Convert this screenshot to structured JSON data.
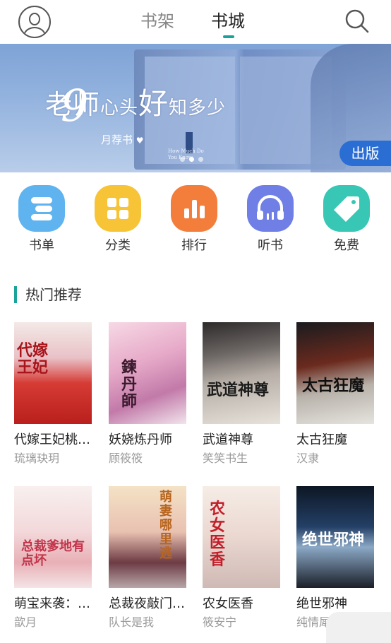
{
  "header": {
    "tabs": [
      {
        "label": "书架",
        "active": false
      },
      {
        "label": "书城",
        "active": true
      }
    ],
    "icons": {
      "left": "user-avatar-icon",
      "right": "search-icon"
    }
  },
  "banner": {
    "title_part1": "老师",
    "title_part2": "心头",
    "title_part3": "好",
    "title_part4": "知多少",
    "english_text": "How Much Do You Know",
    "number": "9",
    "subtitle": "月荐书",
    "publish_tag": "出版",
    "page_indicator": {
      "count": 3,
      "active": 1
    }
  },
  "categories": [
    {
      "label": "书单",
      "icon": "booklist-icon",
      "color": "#5fb4f0"
    },
    {
      "label": "分类",
      "icon": "category-grid-icon",
      "color": "#f6c436"
    },
    {
      "label": "排行",
      "icon": "ranking-bars-icon",
      "color": "#f37d3a"
    },
    {
      "label": "听书",
      "icon": "headphones-icon",
      "color": "#6f7fe6"
    },
    {
      "label": "免费",
      "icon": "price-tag-icon",
      "color": "#37c7b4"
    }
  ],
  "section": {
    "title": "热门推荐",
    "accent": "#1aa39a"
  },
  "books": [
    {
      "title": "代嫁王妃桃…",
      "author": "琉璃玦玥",
      "cover_text": "代嫁王妃"
    },
    {
      "title": "妖娆炼丹师",
      "author": "顾筱筱",
      "cover_text": "鍊丹師"
    },
    {
      "title": "武道神尊",
      "author": "笑笑书生",
      "cover_text": "武道神尊"
    },
    {
      "title": "太古狂魔",
      "author": "汉隶",
      "cover_text": "太古狂魔"
    },
    {
      "title": "萌宝来袭：…",
      "author": "歆月",
      "cover_text": "总裁爹地有点坏"
    },
    {
      "title": "总裁夜敲门…",
      "author": "队长是我",
      "cover_text": "萌妻哪里逃"
    },
    {
      "title": "农女医香",
      "author": "筱安宁",
      "cover_text": "农女医香"
    },
    {
      "title": "绝世邪神",
      "author": "纯情犀利哥",
      "cover_text": "绝世邪神"
    }
  ]
}
